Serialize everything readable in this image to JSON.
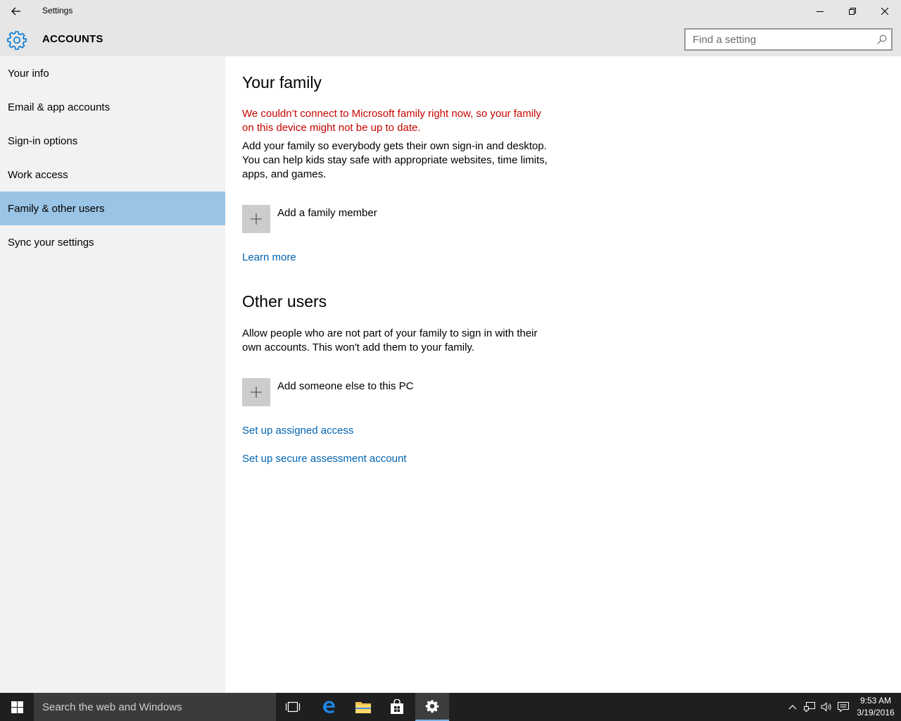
{
  "window": {
    "title": "Settings"
  },
  "header": {
    "section": "ACCOUNTS",
    "search_placeholder": "Find a setting"
  },
  "sidebar": {
    "items": [
      {
        "label": "Your info"
      },
      {
        "label": "Email & app accounts"
      },
      {
        "label": "Sign-in options"
      },
      {
        "label": "Work access"
      },
      {
        "label": "Family & other users",
        "selected": true
      },
      {
        "label": "Sync your settings"
      }
    ]
  },
  "main": {
    "family": {
      "heading": "Your family",
      "error": "We couldn’t connect to Microsoft family right now, so your family on this device might not be up to date.",
      "description": "Add your family so everybody gets their own sign-in and desktop. You can help kids stay safe with appropriate websites, time limits, apps, and games.",
      "add_label": "Add a family member",
      "learn_more": "Learn more"
    },
    "other": {
      "heading": "Other users",
      "description": "Allow people who are not part of your family to sign in with their own accounts. This won't add them to your family.",
      "add_label": "Add someone else to this PC",
      "assigned_access": "Set up assigned access",
      "assessment": "Set up secure assessment account"
    }
  },
  "taskbar": {
    "search_placeholder": "Search the web and Windows",
    "time": "9:53 AM",
    "date": "3/19/2016"
  },
  "colors": {
    "selected_nav": "#99c4e6",
    "link": "#0063b1",
    "error": "#c50500",
    "accent": "#0078d7"
  }
}
